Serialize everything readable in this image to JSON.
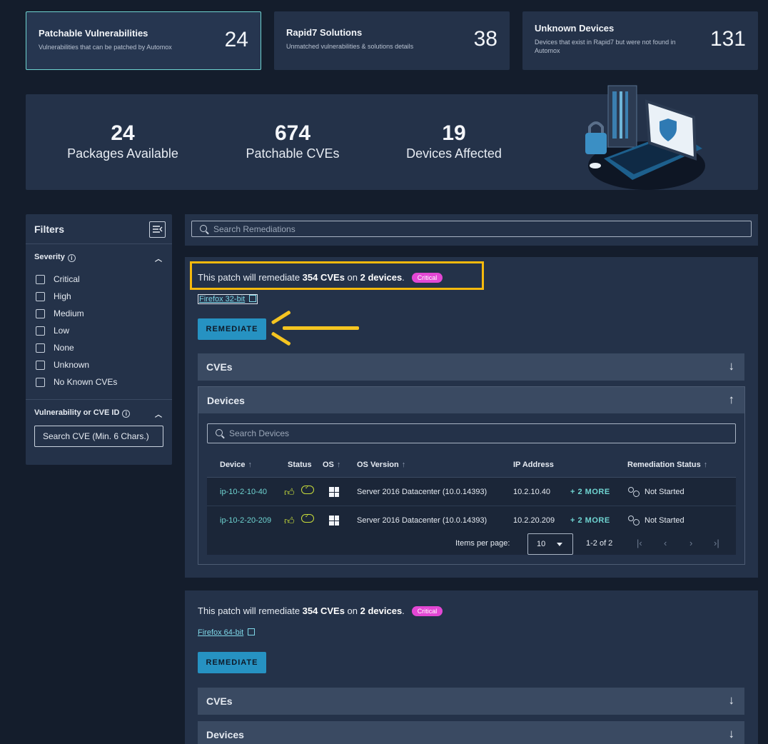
{
  "top_cards": [
    {
      "title": "Patchable Vulnerabilities",
      "subtitle": "Vulnerabilities that can be patched by Automox",
      "count": "24"
    },
    {
      "title": "Rapid7 Solutions",
      "subtitle": "Unmatched vulnerabilities & solutions details",
      "count": "38"
    },
    {
      "title": "Unknown Devices",
      "subtitle": "Devices that exist in Rapid7 but were not found in Automox",
      "count": "131"
    }
  ],
  "stats": [
    {
      "value": "24",
      "label": "Packages Available"
    },
    {
      "value": "674",
      "label": "Patchable CVEs"
    },
    {
      "value": "19",
      "label": "Devices Affected"
    }
  ],
  "filters": {
    "title": "Filters",
    "severity_title": "Severity",
    "severity_options": [
      "Critical",
      "High",
      "Medium",
      "Low",
      "None",
      "Unknown",
      "No Known CVEs"
    ],
    "cve_title": "Vulnerability or CVE ID",
    "cve_placeholder": "Search CVE (Min. 6 Chars.)"
  },
  "search_remediations_placeholder": "Search Remediations",
  "patches": [
    {
      "text_prefix": "This patch will remediate ",
      "cves": "354 CVEs",
      "text_mid": " on ",
      "devices": "2 devices",
      "text_suffix": ".",
      "severity": "Critical",
      "package": "Firefox 32-bit",
      "button": "REMEDIATE",
      "cves_section": "CVEs",
      "devices_section": "Devices"
    },
    {
      "text_prefix": "This patch will remediate ",
      "cves": "354 CVEs",
      "text_mid": " on ",
      "devices": "2 devices",
      "text_suffix": ".",
      "severity": "Critical",
      "package": "Firefox 64-bit",
      "button": "REMEDIATE",
      "cves_section": "CVEs",
      "devices_section": "Devices"
    }
  ],
  "devices_table": {
    "search_placeholder": "Search Devices",
    "headers": {
      "device": "Device",
      "status": "Status",
      "os": "OS",
      "os_version": "OS Version",
      "ip": "IP Address",
      "remediation": "Remediation Status"
    },
    "rows": [
      {
        "device": "ip-10-2-10-40",
        "os_version": "Server 2016 Datacenter (10.0.14393)",
        "ip": "10.2.10.40",
        "more": "+ 2 MORE",
        "remediation": "Not Started"
      },
      {
        "device": "ip-10-2-20-209",
        "os_version": "Server 2016 Datacenter (10.0.14393)",
        "ip": "10.2.20.209",
        "more": "+ 2 MORE",
        "remediation": "Not Started"
      }
    ],
    "items_per_page_label": "Items per page:",
    "items_per_page": "10",
    "range": "1-2 of 2"
  },
  "colors": {
    "accent": "#6fd4d1",
    "button": "#2692c2",
    "critical": "#e347d4",
    "highlight": "#f5b90d"
  }
}
